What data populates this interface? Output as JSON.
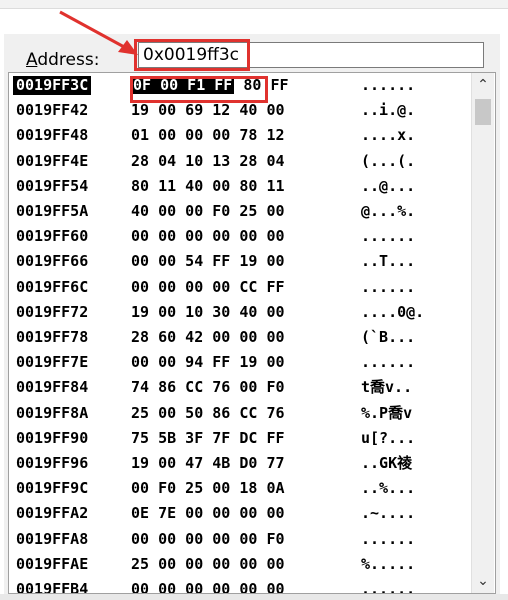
{
  "address_bar": {
    "label": "Address:",
    "label_accel": "A",
    "label_rest": "ddress:",
    "value": "0x0019ff3c"
  },
  "memory": {
    "rows": [
      {
        "addr": "0019FF3C",
        "bytes": [
          "0F",
          "00",
          "F1",
          "FF",
          "80",
          "FF"
        ],
        "ascii": "......",
        "selected": true
      },
      {
        "addr": "0019FF42",
        "bytes": [
          "19",
          "00",
          "69",
          "12",
          "40",
          "00"
        ],
        "ascii": "..i.@."
      },
      {
        "addr": "0019FF48",
        "bytes": [
          "01",
          "00",
          "00",
          "00",
          "78",
          "12"
        ],
        "ascii": "....x."
      },
      {
        "addr": "0019FF4E",
        "bytes": [
          "28",
          "04",
          "10",
          "13",
          "28",
          "04"
        ],
        "ascii": "(...(."
      },
      {
        "addr": "0019FF54",
        "bytes": [
          "80",
          "11",
          "40",
          "00",
          "80",
          "11"
        ],
        "ascii": "..@..."
      },
      {
        "addr": "0019FF5A",
        "bytes": [
          "40",
          "00",
          "00",
          "F0",
          "25",
          "00"
        ],
        "ascii": "@...%."
      },
      {
        "addr": "0019FF60",
        "bytes": [
          "00",
          "00",
          "00",
          "00",
          "00",
          "00"
        ],
        "ascii": "......"
      },
      {
        "addr": "0019FF66",
        "bytes": [
          "00",
          "00",
          "54",
          "FF",
          "19",
          "00"
        ],
        "ascii": "..T..."
      },
      {
        "addr": "0019FF6C",
        "bytes": [
          "00",
          "00",
          "00",
          "00",
          "CC",
          "FF"
        ],
        "ascii": "......"
      },
      {
        "addr": "0019FF72",
        "bytes": [
          "19",
          "00",
          "10",
          "30",
          "40",
          "00"
        ],
        "ascii": "....0@."
      },
      {
        "addr": "0019FF78",
        "bytes": [
          "28",
          "60",
          "42",
          "00",
          "00",
          "00"
        ],
        "ascii": "(`B..."
      },
      {
        "addr": "0019FF7E",
        "bytes": [
          "00",
          "00",
          "94",
          "FF",
          "19",
          "00"
        ],
        "ascii": "......"
      },
      {
        "addr": "0019FF84",
        "bytes": [
          "74",
          "86",
          "CC",
          "76",
          "00",
          "F0"
        ],
        "ascii": "t喬v.."
      },
      {
        "addr": "0019FF8A",
        "bytes": [
          "25",
          "00",
          "50",
          "86",
          "CC",
          "76"
        ],
        "ascii": "%.P喬v"
      },
      {
        "addr": "0019FF90",
        "bytes": [
          "75",
          "5B",
          "3F",
          "7F",
          "DC",
          "FF"
        ],
        "ascii": "u[?..."
      },
      {
        "addr": "0019FF96",
        "bytes": [
          "19",
          "00",
          "47",
          "4B",
          "D0",
          "77"
        ],
        "ascii": "..GK祾"
      },
      {
        "addr": "0019FF9C",
        "bytes": [
          "00",
          "F0",
          "25",
          "00",
          "18",
          "0A"
        ],
        "ascii": "..%..."
      },
      {
        "addr": "0019FFA2",
        "bytes": [
          "0E",
          "7E",
          "00",
          "00",
          "00",
          "00"
        ],
        "ascii": ".~...."
      },
      {
        "addr": "0019FFA8",
        "bytes": [
          "00",
          "00",
          "00",
          "00",
          "00",
          "F0"
        ],
        "ascii": "......"
      },
      {
        "addr": "0019FFAE",
        "bytes": [
          "25",
          "00",
          "00",
          "00",
          "00",
          "00"
        ],
        "ascii": "%....."
      },
      {
        "addr": "0019FFB4",
        "bytes": [
          "00",
          "00",
          "00",
          "00",
          "00",
          "00"
        ],
        "ascii": "......"
      }
    ]
  },
  "highlight": {
    "bytes": [
      "0F",
      "00",
      "F1",
      "FF"
    ],
    "box_color": "#e0322e"
  },
  "scrollbar": {
    "up_icon": "chevron-up-icon",
    "down_icon": "chevron-down-icon"
  }
}
